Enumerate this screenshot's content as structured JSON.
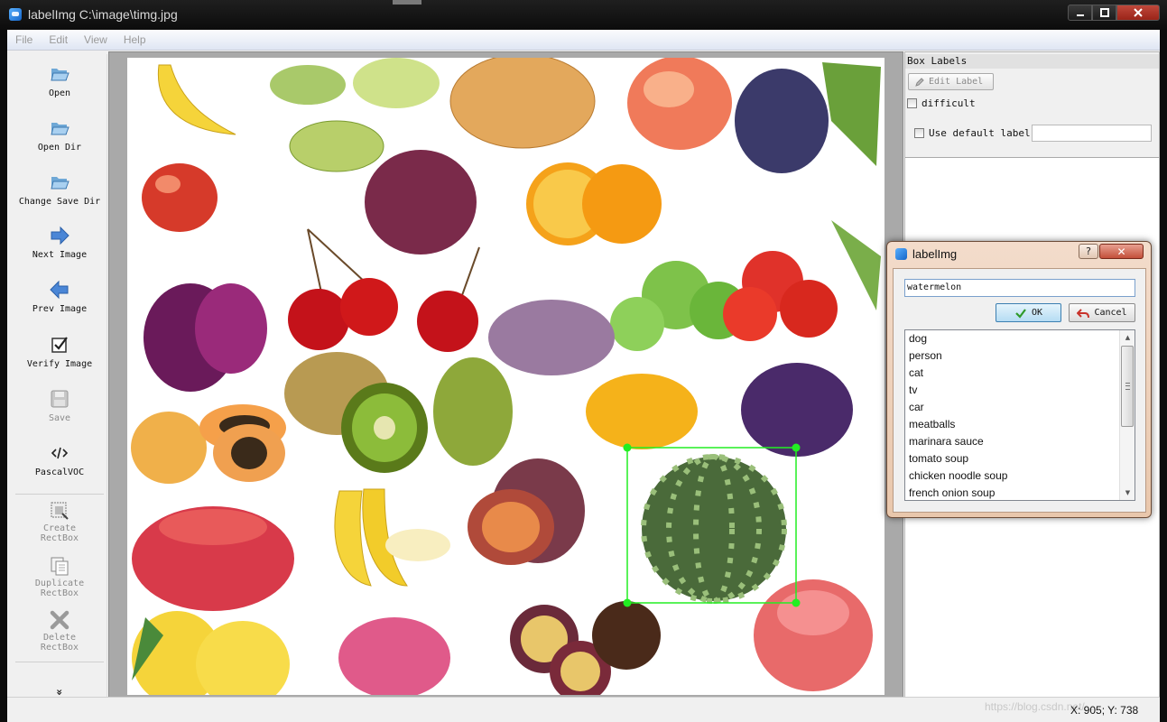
{
  "window": {
    "title": "labelImg C:\\image\\timg.jpg"
  },
  "menu": [
    "File",
    "Edit",
    "View",
    "Help"
  ],
  "toolbar": {
    "open": "Open",
    "open_dir": "Open Dir",
    "change_save_dir": "Change Save Dir",
    "next_image": "Next Image",
    "prev_image": "Prev Image",
    "verify_image": "Verify Image",
    "save": "Save",
    "format": "PascalVOC",
    "create_rectbox": [
      "Create",
      "RectBox"
    ],
    "duplicate_rectbox": [
      "Duplicate",
      "RectBox"
    ],
    "delete_rectbox": [
      "Delete",
      "RectBox"
    ],
    "more": "»"
  },
  "box_labels": {
    "title": "Box Labels",
    "edit_label": "Edit Label",
    "difficult": "difficult",
    "use_default_label": "Use default label"
  },
  "dialog": {
    "title": "labelImg",
    "help": "?",
    "close": "✕",
    "input_value": "watermelon",
    "ok": "OK",
    "cancel": "Cancel",
    "labels": [
      "dog",
      "person",
      "cat",
      "tv",
      "car",
      "meatballs",
      "marinara sauce",
      "tomato soup",
      "chicken noodle soup",
      "french onion soup"
    ]
  },
  "status": {
    "coords": "X: 905; Y: 738",
    "watermark": "https://blog.csdn.net/..."
  },
  "colors": {
    "bbox": "#22ee22",
    "canvas_bg": "#a9a9a9",
    "accent": "#3c7fb1"
  }
}
